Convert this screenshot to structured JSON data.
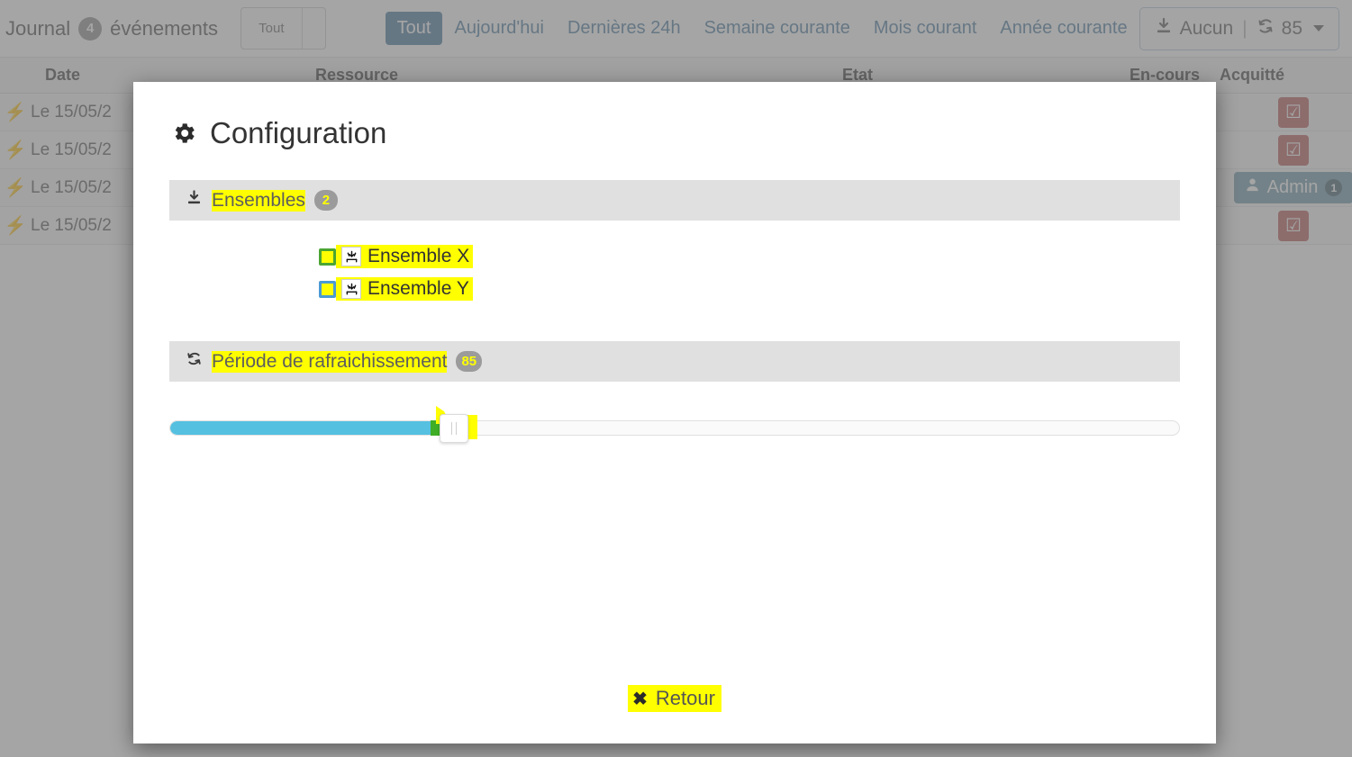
{
  "journal": {
    "title": "Journal",
    "count": "4",
    "subtitle": "événements",
    "type_select_value": "Tout",
    "period_tabs": [
      {
        "label": "Tout",
        "active": true
      },
      {
        "label": "Aujourd'hui",
        "active": false
      },
      {
        "label": "Dernières 24h",
        "active": false
      },
      {
        "label": "Semaine courante",
        "active": false
      },
      {
        "label": "Mois courant",
        "active": false
      },
      {
        "label": "Année courante",
        "active": false
      }
    ],
    "export": {
      "download_icon": "download-icon",
      "label": "Aucun",
      "separator": "|",
      "refresh_icon": "refresh-icon",
      "refresh_value": "85"
    },
    "table": {
      "columns": [
        "Date",
        "Ressource",
        "Etat",
        "En-cours",
        "Acquitté"
      ],
      "rows": [
        {
          "icon": "bolt-icon",
          "date": "Le 15/05/2",
          "action": "check-square",
          "action_label": ""
        },
        {
          "icon": "bolt-icon",
          "date": "Le 15/05/2",
          "action": "check-square",
          "action_label": ""
        },
        {
          "icon": "bolt-icon",
          "date": "Le 15/05/2",
          "action": "admin",
          "action_label": "Admin",
          "action_badge": "1"
        },
        {
          "icon": "bolt-icon",
          "date": "Le 15/05/2",
          "action": "check-square",
          "action_label": ""
        }
      ]
    }
  },
  "modal": {
    "title": "Configuration",
    "title_icon": "gear-icon",
    "sections": {
      "ensembles": {
        "icon": "download-icon",
        "label": "Ensembles",
        "badge": "2",
        "items": [
          {
            "label": "Ensemble X",
            "icon": "import-icon",
            "checked": false,
            "outline": "#4aa533"
          },
          {
            "label": "Ensemble Y",
            "icon": "import-icon",
            "checked": false,
            "outline": "#4a9ad4"
          }
        ]
      },
      "refresh": {
        "icon": "refresh-icon",
        "label": "Période de rafraichissement",
        "badge": "85",
        "slider": {
          "value": 85,
          "min": 0,
          "max": 300,
          "fill_percent": 26,
          "fill_color": "#55c0e0",
          "track_color": "#fafafa"
        }
      }
    },
    "footer": {
      "back_icon": "close-x-icon",
      "back_label": "Retour"
    }
  },
  "colors": {
    "accent_blue": "#5b87a8",
    "slider_blue": "#55c0e0",
    "highlight_yellow": "#ffff00",
    "badge_gray": "#9b9b9b",
    "check_red": "#c06a6a",
    "admin_teal": "#7ba3b2"
  }
}
